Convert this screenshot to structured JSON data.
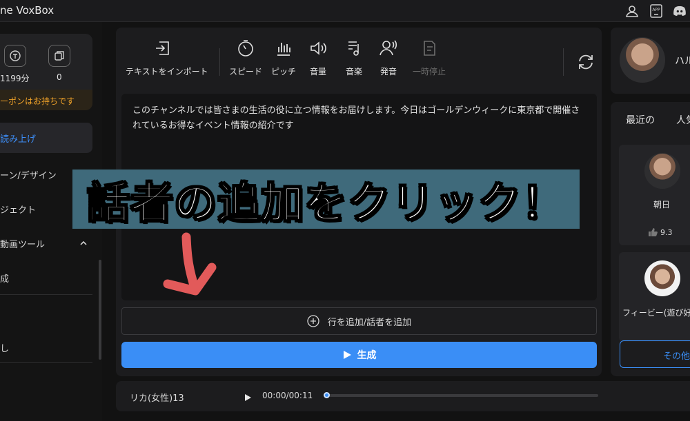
{
  "app": {
    "title": "ne VoxBox"
  },
  "titlebar_icons": [
    "user-icon",
    "app-icon",
    "discord-icon"
  ],
  "sidebar": {
    "quota": [
      {
        "icon": "text-quota-icon",
        "value": "1199分"
      },
      {
        "icon": "copy-quota-icon",
        "value": "0"
      }
    ],
    "coupon_text": "ーポンはお持ちです",
    "items": [
      {
        "label": "読み上げ",
        "active": true
      },
      {
        "label": "ーン/デザイン"
      },
      {
        "label": "ジェクト"
      },
      {
        "label": "動画ツール",
        "expanded": true
      },
      {
        "label": "成"
      },
      {
        "label": "し"
      }
    ]
  },
  "toolbar": {
    "import_label": "テキストをインポート",
    "speed_label": "スピード",
    "pitch_label": "ピッチ",
    "volume_label": "音量",
    "music_label": "音楽",
    "pronounce_label": "発音",
    "pause_label": "一時停止"
  },
  "editor": {
    "text": "このチャンネルでは皆さまの生活の役に立つ情報をお届けします。今日はゴールデンウィークに東京都で開催されているお得なイベント情報の紹介です"
  },
  "add_row_label": "行を追加/話者を追加",
  "generate_label": "生成",
  "player": {
    "voice": "リカ(女性)13",
    "time": "00:00/00:11",
    "progress": 0
  },
  "profile": {
    "name": "ハル"
  },
  "voice_list": {
    "tabs": [
      "最近の",
      "人気"
    ],
    "cards": [
      {
        "name": "朝日",
        "rating": "9.3"
      },
      {
        "name": "フィービー(遊び好き"
      }
    ],
    "more_label": "その他"
  },
  "annotation": {
    "banner": "話者の追加をクリック！",
    "arrow_color": "#e25a5a",
    "banner_color": "#3f6a7b"
  },
  "colors": {
    "accent": "#3a8ef6",
    "coupon": "#f0a229"
  }
}
